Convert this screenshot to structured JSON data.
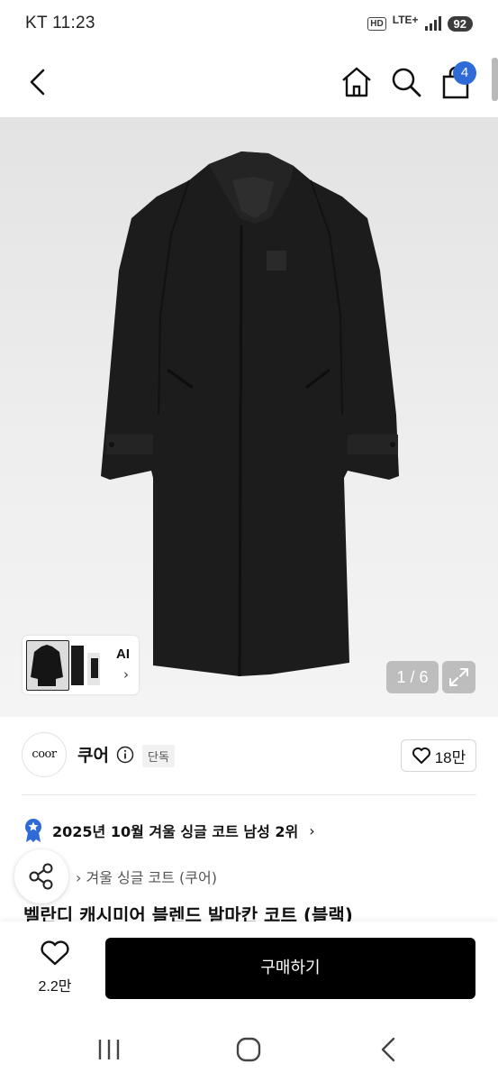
{
  "status_bar": {
    "carrier_time": "KT 11:23",
    "hd": "HD",
    "network": "LTE+",
    "battery": "92"
  },
  "header": {
    "cart_count": "4"
  },
  "gallery": {
    "ai_label": "AI",
    "ai_chevron": "›",
    "pager": "1 / 6"
  },
  "brand": {
    "logo_text": "coor",
    "name": "쿠어",
    "exclusive_badge": "단독",
    "likes": "18만"
  },
  "ranking": {
    "text": "2025년 10월 겨울 싱글 코트 남성 2위",
    "chevron": "›"
  },
  "breadcrumb": "› 겨울 싱글 코트 (쿠어)",
  "product_title": "벨란디 캐시미어 블렌드 발마칸 코트 (블랙)",
  "bottom_bar": {
    "wish_count": "2.2만",
    "buy_label": "구매하기"
  },
  "colors": {
    "accent_blue": "#2f6bd7",
    "buy_button": "#000000",
    "coat": "#1c1c1c"
  },
  "icons": [
    "back-icon",
    "home-icon",
    "search-icon",
    "shopping-bag-icon",
    "info-icon",
    "heart-icon",
    "medal-icon",
    "share-icon",
    "expand-icon",
    "recent-apps-icon",
    "nav-home-icon",
    "nav-back-icon"
  ]
}
